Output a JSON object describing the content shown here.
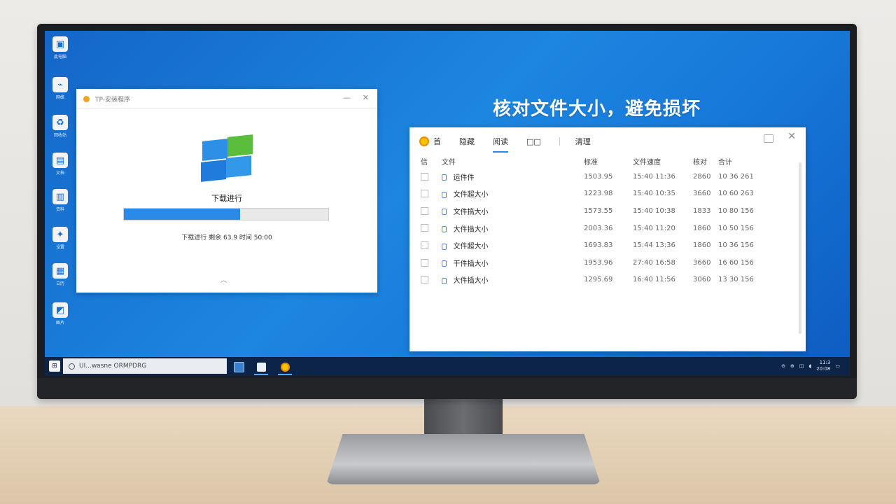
{
  "desktop_icons": [
    {
      "label": "此电脑",
      "icon": "computer-icon",
      "glyph": "▣"
    },
    {
      "label": "网络",
      "icon": "network-icon",
      "glyph": "⌁"
    },
    {
      "label": "回收站",
      "icon": "recycle-icon",
      "glyph": "♻"
    },
    {
      "label": "文档",
      "icon": "document-icon",
      "glyph": "▤"
    },
    {
      "label": "资料",
      "icon": "book-icon",
      "glyph": "▥"
    },
    {
      "label": "设置",
      "icon": "settings-icon",
      "glyph": "✦"
    },
    {
      "label": "日历",
      "icon": "calendar-icon",
      "glyph": "▦"
    },
    {
      "label": "图片",
      "icon": "picture-icon",
      "glyph": "◩"
    }
  ],
  "download_window": {
    "title": "TP-安装程序",
    "min_glyph": "—",
    "close_glyph": "✕",
    "heading": "下载进行",
    "progress_fraction": 0.57,
    "status": "下载进行  剩余 63.9  时间 50:00",
    "collapse_glyph": "︿"
  },
  "headline": "核对文件大小，避免损坏",
  "file_window": {
    "tabs": [
      {
        "label": "首",
        "icon": true
      },
      {
        "label": "隐藏"
      },
      {
        "label": "阅读",
        "active": true
      },
      {
        "label": "□□",
        "separator_after": true
      },
      {
        "label": "清理"
      }
    ],
    "close_glyph": "✕",
    "columns": [
      "信",
      "文件",
      "标准",
      "文件速度",
      "核对",
      "合计"
    ],
    "rows": [
      {
        "name": "运件件",
        "size": "1503.95",
        "time": "15:40 11:36",
        "check": "2860",
        "total": "10 36 261"
      },
      {
        "name": "文件超大小",
        "size": "1223.98",
        "time": "15:40 10:35",
        "check": "3660",
        "total": "10 60 263"
      },
      {
        "name": "文件搞大小",
        "size": "1573.55",
        "time": "15:40 10:38",
        "check": "1833",
        "total": "10 80 156"
      },
      {
        "name": "大件描大小",
        "size": "2003.36",
        "time": "15:40 11:20",
        "check": "1860",
        "total": "10 50 156"
      },
      {
        "name": "文件超大小",
        "size": "1693.83",
        "time": "15:44 13:36",
        "check": "1860",
        "total": "10 36 156"
      },
      {
        "name": "干件插大小",
        "size": "1953.96",
        "time": "27:40 16:58",
        "check": "3660",
        "total": "16 60 156"
      },
      {
        "name": "大件插大小",
        "size": "1295.69",
        "time": "16:40 11:56",
        "check": "3060",
        "total": "13 30 156"
      }
    ]
  },
  "taskbar": {
    "start_glyph": "⊞",
    "search_placeholder": "UI...wasne ORMPDRG",
    "tray_time": "11:3",
    "tray_date": "20:08"
  },
  "colors": {
    "accent": "#2b89e8",
    "desktop": "#1c86e0",
    "taskbar": "#0c2448"
  }
}
